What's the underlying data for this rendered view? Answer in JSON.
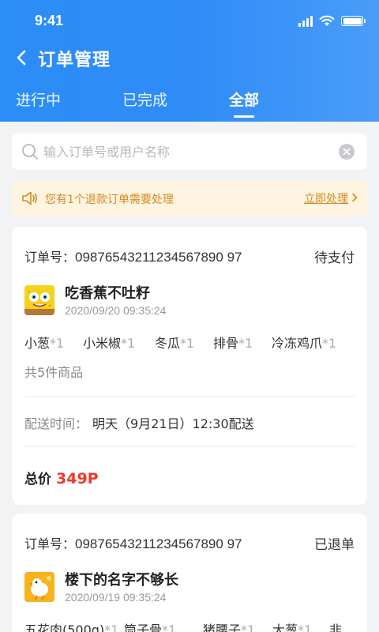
{
  "status_bar": {
    "time": "9:41"
  },
  "header": {
    "title": "订单管理"
  },
  "tabs": [
    {
      "label": "进行中"
    },
    {
      "label": "已完成"
    },
    {
      "label": "全部",
      "active": true
    }
  ],
  "search": {
    "placeholder": "输入订单号或用户名称",
    "value": ""
  },
  "notice": {
    "text": "您有1个退款订单需要处理",
    "action": "立即处理"
  },
  "orders": [
    {
      "order_no_label": "订单号：",
      "order_no": "09876543211234567890 97",
      "status": "待支付",
      "shop_name": "吃香蕉不吐籽",
      "time": "2020/09/20 09:35:24",
      "items": [
        {
          "name": "小葱",
          "qty": "*1"
        },
        {
          "name": "小米椒",
          "qty": "*1"
        },
        {
          "name": "冬瓜",
          "qty": "*1"
        },
        {
          "name": "排骨",
          "qty": "*1"
        },
        {
          "name": "冷冻鸡爪",
          "qty": "*1"
        }
      ],
      "item_count": "共5件商品",
      "delivery_label": "配送时间：",
      "delivery_value": "明天（9月21日）12:30配送",
      "total_label": "总价",
      "total_value": "349P"
    },
    {
      "order_no_label": "订单号：",
      "order_no": "09876543211234567890 97",
      "status": "已退单",
      "shop_name": "楼下的名字不够长",
      "time": "2020/09/19 09:35:24",
      "items": [
        {
          "name": "五花肉(500g)",
          "qty": "*1"
        },
        {
          "name": "筒子骨",
          "qty": "*1"
        },
        {
          "name": "猪腰子",
          "qty": "*1"
        },
        {
          "name": "大葱",
          "qty": "*1"
        },
        {
          "name": "非...",
          "qty": ""
        }
      ]
    }
  ],
  "colors": {
    "header_blue": "#2b8df7",
    "price_red": "#f0382c",
    "notice_orange": "#d38a21",
    "notice_bg": "#fef4e0"
  },
  "icons": [
    "back-chevron-icon",
    "search-icon",
    "clear-icon",
    "megaphone-icon",
    "chevron-right-icon",
    "signal-icon",
    "wifi-icon",
    "battery-icon"
  ]
}
